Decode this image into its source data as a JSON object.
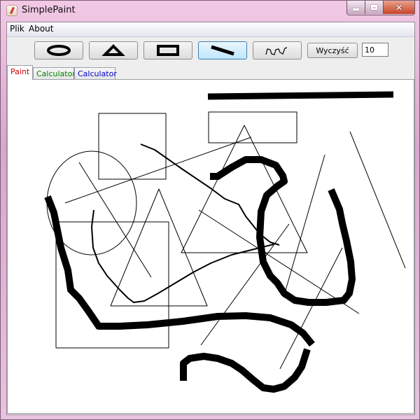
{
  "window": {
    "title": "SimplePaint"
  },
  "menu": {
    "items": [
      "Plik",
      "About"
    ]
  },
  "toolbar": {
    "tools": [
      "ellipse-tool",
      "triangle-tool",
      "rectangle-tool",
      "line-tool",
      "freehand-tool"
    ],
    "selected_tool": "line-tool",
    "clear_label": "Wyczyść",
    "size_value": "10"
  },
  "tabs": [
    {
      "label": "Paint",
      "color": "#cc0000",
      "active": true
    },
    {
      "label": "Calculator",
      "color": "#008000",
      "active": false
    },
    {
      "label": "Calculator",
      "color": "#0000cc",
      "active": false
    }
  ]
}
